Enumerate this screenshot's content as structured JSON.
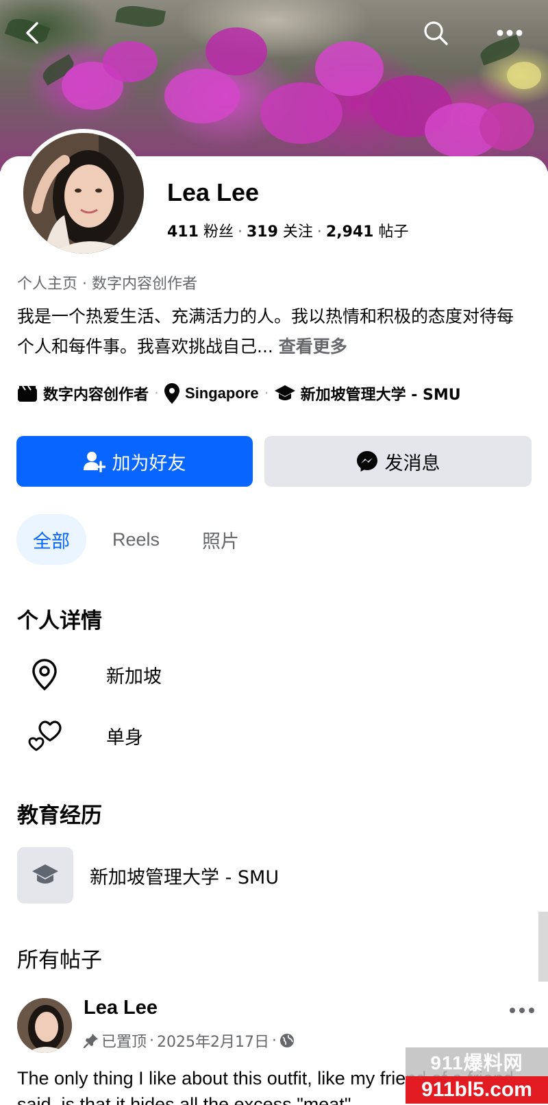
{
  "profile": {
    "name": "Lea Lee",
    "followers_count": "411",
    "followers_label": "粉丝",
    "following_count": "319",
    "following_label": "关注",
    "posts_count": "2,941",
    "posts_label": "帖子",
    "category": "个人主页 · 数字内容创作者",
    "bio": "我是一个热爱生活、充满活力的人。我以热情和积极的态度对待每个人和每件事。我喜欢挑战自己...",
    "see_more": "查看更多",
    "meta": {
      "job": "数字内容创作者",
      "location": "Singapore",
      "school": "新加坡管理大学 - SMU"
    }
  },
  "actions": {
    "add_friend": "加为好友",
    "message": "发消息"
  },
  "tabs": [
    {
      "label": "全部",
      "active": true
    },
    {
      "label": "Reels",
      "active": false
    },
    {
      "label": "照片",
      "active": false
    }
  ],
  "details": {
    "title": "个人详情",
    "location": "新加坡",
    "relationship": "单身"
  },
  "education": {
    "title": "教育经历",
    "school": "新加坡管理大学 - SMU"
  },
  "posts": {
    "title": "所有帖子",
    "first": {
      "author": "Lea Lee",
      "pinned": "已置顶",
      "date": "2025年2月17日",
      "text": "The only thing I like about this outfit, like my friend of a friend said, is that it hides all the excess \"meat\""
    }
  },
  "watermark": {
    "top": "911爆料网",
    "bottom": "911bl5.com"
  },
  "colors": {
    "primary": "#0866ff",
    "secondary_bg": "#e4e6eb",
    "muted_text": "#65676b"
  }
}
